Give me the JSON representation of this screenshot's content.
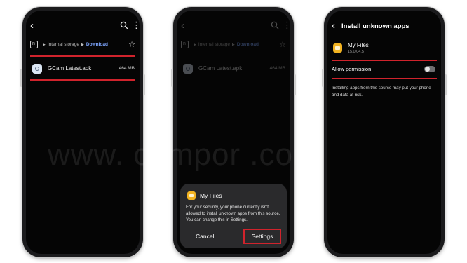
{
  "watermark": "www.  campor  .com",
  "screen1": {
    "breadcrumb": {
      "root": "Internal storage",
      "current": "Download"
    },
    "file": {
      "name": "GCam Latest.apk",
      "size": "464 MB"
    }
  },
  "screen2": {
    "breadcrumb": {
      "root": "Internal storage",
      "current": "Download"
    },
    "file": {
      "name": "GCam Latest.apk",
      "size": "464 MB"
    },
    "dialog": {
      "title": "My Files",
      "body": "For your security, your phone currently isn't allowed to install unknown apps from this source. You can change this in Settings.",
      "cancel_label": "Cancel",
      "settings_label": "Settings"
    }
  },
  "screen3": {
    "title": "Install unknown apps",
    "app": {
      "name": "My Files",
      "version": "15.0.04.5"
    },
    "permission_label": "Allow permission",
    "permission_enabled": false,
    "note": "Installing apps from this source may put your phone and data at risk."
  },
  "colors": {
    "highlight": "#d0232c",
    "link": "#7ea6ff",
    "folder": "#f2b321"
  }
}
